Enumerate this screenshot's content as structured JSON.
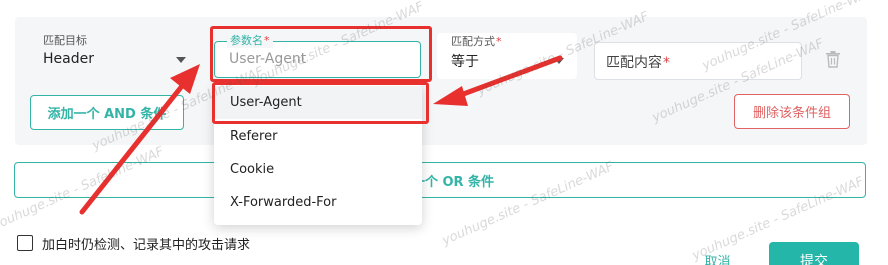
{
  "condition_group": {
    "target": {
      "label": "匹配目标",
      "value": "Header"
    },
    "param_name": {
      "label": "参数名",
      "required_mark": "*",
      "placeholder": "User-Agent"
    },
    "match_method": {
      "label": "匹配方式",
      "required_mark": "*",
      "value": "等于"
    },
    "match_content": {
      "placeholder": "匹配内容",
      "required_mark": "*"
    },
    "add_and_label": "添加一个 AND 条件",
    "delete_group_label": "删除该条件组"
  },
  "add_or_label": "添加一个 OR 条件",
  "dropdown": {
    "options": [
      "User-Agent",
      "Referer",
      "Cookie",
      "X-Forwarded-For"
    ],
    "highlighted_index": 0
  },
  "whitelist_checkbox": {
    "label": "加白时仍检测、记录其中的攻击请求",
    "checked": false
  },
  "footer": {
    "cancel_label": "取消",
    "submit_label": "提交"
  },
  "watermark": "youhuge.site - SafeLine-WAF",
  "colors": {
    "accent": "#33b4a7",
    "danger": "#e06262",
    "annotation": "#e8302e",
    "panel": "#f4f6f8"
  },
  "icons": {
    "delete": "trash-icon",
    "dropdown": "caret-down-icon"
  }
}
